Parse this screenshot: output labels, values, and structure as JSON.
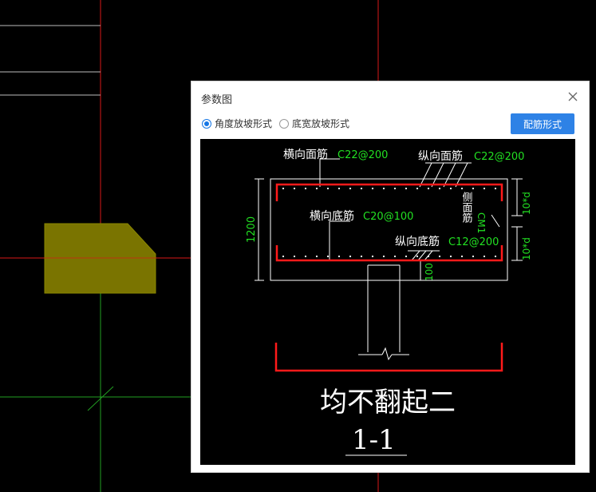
{
  "dialog": {
    "title": "参数图",
    "options": [
      {
        "label": "角度放坡形式",
        "selected": true
      },
      {
        "label": "底宽放坡形式",
        "selected": false
      }
    ],
    "rebar_button": "配筋形式"
  },
  "drawing": {
    "top_transverse_label": "横向面筋",
    "top_transverse_value": "C22@200",
    "top_longitudinal_label": "纵向面筋",
    "top_longitudinal_value": "C22@200",
    "bottom_transverse_label": "横向底筋",
    "bottom_transverse_value": "C20@100",
    "bottom_longitudinal_label": "纵向底筋",
    "bottom_longitudinal_value": "C12@200",
    "side_label": "侧面筋",
    "side_value": "CM1",
    "height_dim": "1200",
    "anchor_dim_top": "10*d",
    "anchor_dim_bottom": "10*d",
    "cover_dim": "100",
    "caption": "均不翻起二",
    "section_label": "1-1"
  },
  "colors": {
    "cad_background": "#000000",
    "red_axis": "#d81818",
    "green_axis": "#22a022",
    "rebar_red": "#ff1a1a",
    "dim_green": "#22e022",
    "element_fill": "#7a7400"
  }
}
